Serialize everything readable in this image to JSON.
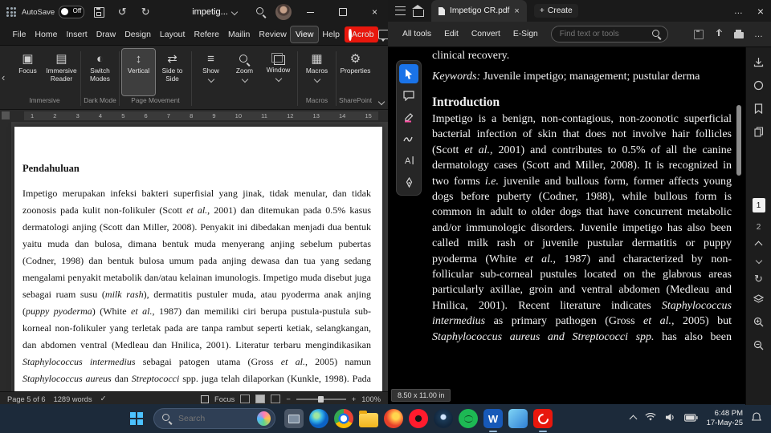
{
  "glyphs": {
    "undo": "↺",
    "redo": "↻",
    "ellipsis": "…",
    "close": "×",
    "plus": "+",
    "ribbon_collapse_left": "‹",
    "check": "✓",
    "minus": "−",
    "plus_zoom": "+",
    "refresh": "↻"
  },
  "word": {
    "titlebar": {
      "autosave_label": "AutoSave",
      "autosave_state": "Off",
      "doc_title": "impetig..."
    },
    "menus": [
      {
        "id": "file",
        "label": "File"
      },
      {
        "id": "home",
        "label": "Home"
      },
      {
        "id": "insert",
        "label": "Insert"
      },
      {
        "id": "draw",
        "label": "Draw"
      },
      {
        "id": "design",
        "label": "Design"
      },
      {
        "id": "layout",
        "label": "Layout"
      },
      {
        "id": "references",
        "label": "Refere"
      },
      {
        "id": "mailings",
        "label": "Mailin"
      },
      {
        "id": "review",
        "label": "Review"
      },
      {
        "id": "view",
        "label": "View",
        "selected": true
      },
      {
        "id": "help",
        "label": "Help"
      },
      {
        "id": "acrobat",
        "label": "Acrob"
      }
    ],
    "ribbon": {
      "buttons": {
        "focus": "Focus",
        "immersive_reader": "Immersive Reader",
        "switch_modes": "Switch Modes",
        "vertical": "Vertical",
        "side_to_side": "Side to Side",
        "show": "Show",
        "zoom": "Zoom",
        "window": "Window",
        "macros": "Macros",
        "properties": "Properties"
      },
      "icons": {
        "focus": "▣",
        "immersive_reader": "▤",
        "switch_modes": "◐",
        "vertical": "↕",
        "side_to_side": "⇄",
        "show": "≡",
        "macros": "▦",
        "properties": "⚙"
      },
      "group_labels": [
        "Immersive",
        "Dark Mode",
        "Page Movement",
        "Macros",
        "SharePoint"
      ]
    },
    "ruler": [
      "1",
      "2",
      "3",
      "4",
      "5",
      "6",
      "7",
      "8",
      "9",
      "10",
      "11",
      "12",
      "13",
      "14",
      "15"
    ],
    "document": {
      "heading": "Pendahuluan",
      "paragraph_runs": [
        {
          "t": "Impetigo merupakan infeksi bakteri superfisial yang jinak, tidak menular, dan tidak zoonosis pada kulit non-folikuler (Scott "
        },
        {
          "t": "et al.",
          "i": true
        },
        {
          "t": ", 2001) dan ditemukan pada 0.5% kasus dermatologi anjing (Scott dan Miller, 2008). Penyakit ini dibedakan menjadi dua bentuk yaitu muda dan bulosa, dimana bentuk muda menyerang anjing sebelum pubertas (Codner, 1998) dan bentuk bulosa umum pada anjing dewasa dan tua yang sedang mengalami penyakit metabolik dan/atau kelainan imunologis. Impetigo muda disebut juga sebagai ruam susu ("
        },
        {
          "t": "milk rash",
          "i": true
        },
        {
          "t": "), dermatitis pustuler muda, atau pyoderma anak anjing ("
        },
        {
          "t": "puppy pyoderma",
          "i": true
        },
        {
          "t": ") (White "
        },
        {
          "t": "et al.",
          "i": true
        },
        {
          "t": ", 1987) dan memiliki ciri berupa pustula-pustula sub-korneal non-folikuler yang terletak pada are tanpa rambut seperti ketiak, selangkangan, dan abdomen ventral (Medleau dan Hnilica, 2001). Literatur terbaru mengindikasikan "
        },
        {
          "t": "Staphylococcus intermedius",
          "i": true
        },
        {
          "t": " sebagai patogen utama (Gross "
        },
        {
          "t": "et al.",
          "i": true
        },
        {
          "t": ", 2005) namun "
        },
        {
          "t": "Staphylococcus aureus",
          "i": true
        },
        {
          "t": " dan "
        },
        {
          "t": "Streptococci",
          "i": true
        },
        {
          "t": " spp. juga telah dilaporkan (Kunkle, 1998). Pada"
        }
      ]
    },
    "statusbar": {
      "page_info": "Page 5 of 6",
      "word_count": "1289 words",
      "focus_label": "Focus",
      "zoom_level": "100%"
    }
  },
  "acrobat": {
    "tabbar": {
      "tab_title": "Impetigo CR.pdf",
      "create_plus": "+",
      "create_label": "Create"
    },
    "toolbar": {
      "items": [
        {
          "id": "all-tools",
          "label": "All tools"
        },
        {
          "id": "edit",
          "label": "Edit"
        },
        {
          "id": "convert",
          "label": "Convert"
        },
        {
          "id": "esign",
          "label": "E-Sign"
        }
      ],
      "search_placeholder": "Find text or tools"
    },
    "page": {
      "top_line": "clinical recovery.",
      "keywords_runs": [
        {
          "t": "Keywords:",
          "i": true
        },
        {
          "t": " Juvenile impetigo; management;  pustular derma"
        }
      ],
      "heading": "Introduction",
      "body_runs": [
        {
          "t": "Impetigo is a benign, non-contagious, non-zoonotic superficial bacterial infection of skin that does not involve hair follicles (Scott "
        },
        {
          "t": "et al.,",
          "i": true
        },
        {
          "t": " 2001) and contributes to 0.5% of all the canine dermatology cases (Scott and Miller, 2008). It is recognized in two forms "
        },
        {
          "t": "i.e.",
          "i": true
        },
        {
          "t": " juvenile and bullous form, former affects young dogs before puberty (Codner, 1988), while bullous form is common in adult to older dogs that have concurrent metabolic and/or immunologic disorders. Juvenile impetigo has also been called milk rash or juvenile pustular dermatitis or puppy pyoderma (White "
        },
        {
          "t": "et al.,",
          "i": true
        },
        {
          "t": " 1987) and characterized by non-follicular sub-corneal pustules located on the glabrous areas particularly axillae, groin and ventral abdomen (Medleau and Hnilica, 2001). Recent literature indicates "
        },
        {
          "t": "Staphylococcus intermedius",
          "i": true
        },
        {
          "t": " as primary pathogen (Gross "
        },
        {
          "t": "et al.,",
          "i": true
        },
        {
          "t": " 2005) but "
        },
        {
          "t": "Staphylococcus aureus and Streptococci spp.",
          "i": true
        },
        {
          "t": " has also been"
        }
      ]
    },
    "pager": {
      "current": "1",
      "next": "2"
    },
    "size_label": "8.50 x 11.00 in"
  },
  "taskbar": {
    "search_placeholder": "Search",
    "icons": [
      {
        "id": "taskview"
      },
      {
        "id": "edge"
      },
      {
        "id": "chrome"
      },
      {
        "id": "explorer"
      },
      {
        "id": "firefox"
      },
      {
        "id": "opera"
      },
      {
        "id": "steam"
      },
      {
        "id": "spotify"
      },
      {
        "id": "word",
        "glyph": "W",
        "selected": true
      },
      {
        "id": "photos"
      },
      {
        "id": "acrobat",
        "selected": true
      }
    ],
    "clock": {
      "time": "6:48 PM",
      "date": "17-May-25"
    }
  }
}
